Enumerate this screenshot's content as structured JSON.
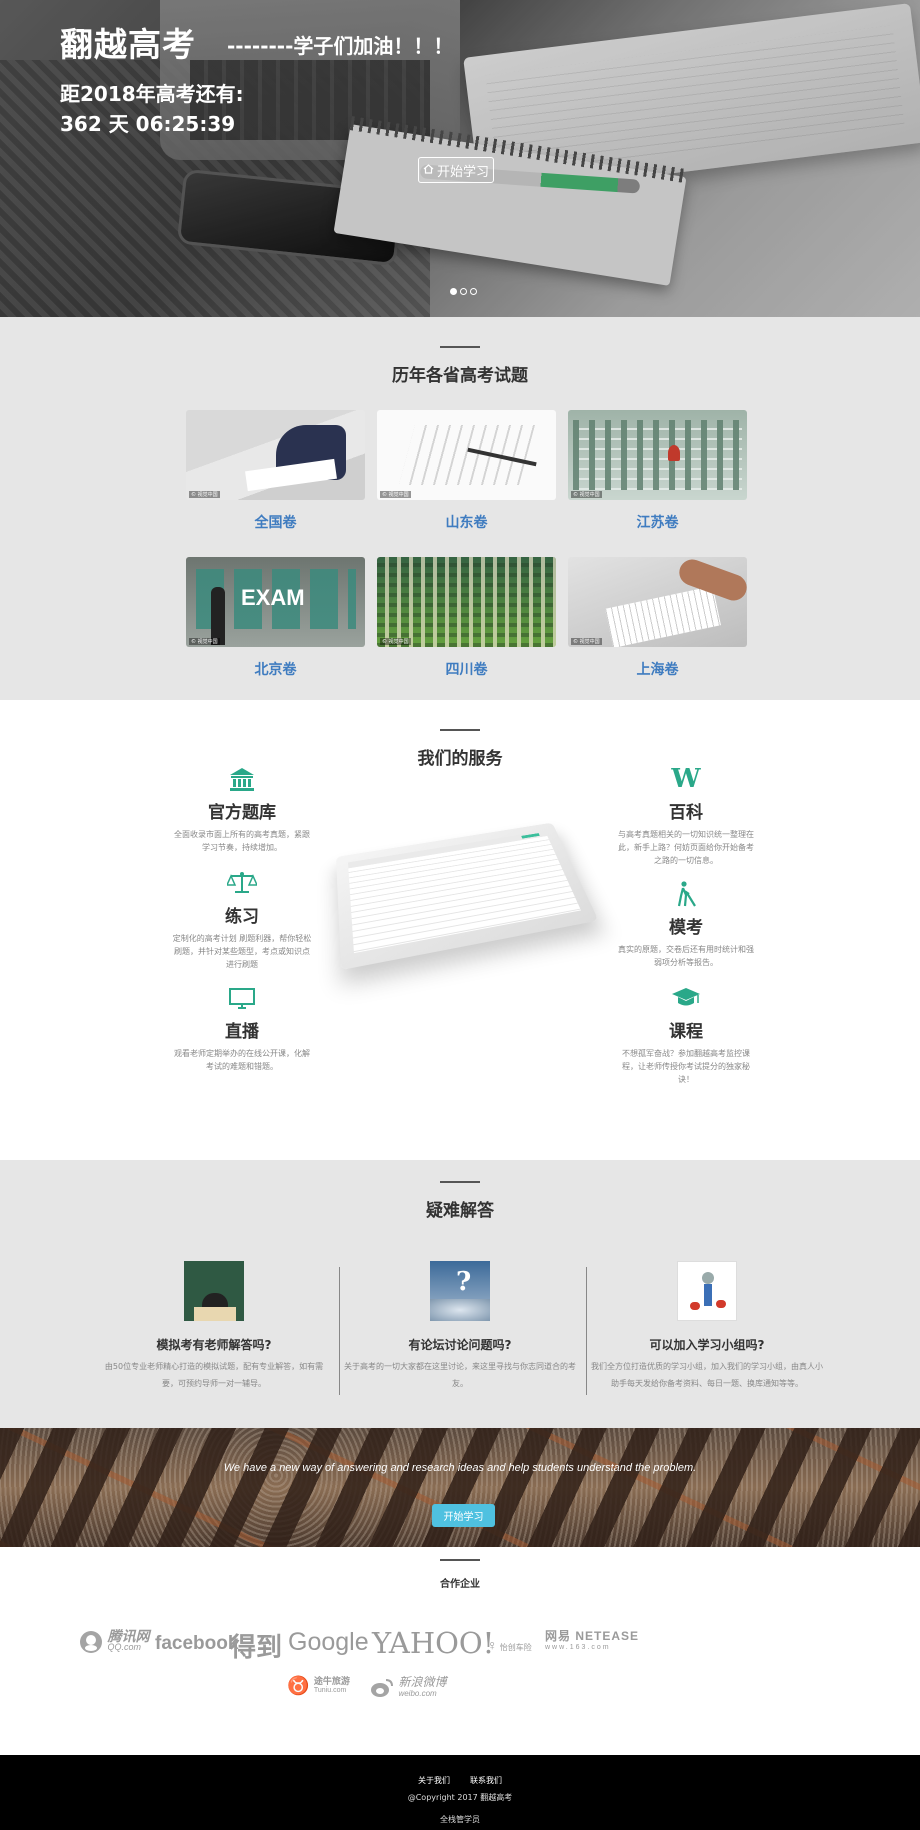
{
  "hero": {
    "brand": "翻越高考",
    "slogan": "--------学子们加油！！！",
    "countdown_label": "距2018年高考还有:",
    "countdown_value": "362 天 06:25:39",
    "start_button": "开始学习",
    "carousel_dots": 3,
    "active_dot": 1
  },
  "exams": {
    "title": "历年各省高考试题",
    "items": [
      {
        "label": "全国卷"
      },
      {
        "label": "山东卷"
      },
      {
        "label": "江苏卷"
      },
      {
        "label": "北京卷"
      },
      {
        "label": "四川卷"
      },
      {
        "label": "上海卷"
      }
    ],
    "image_tag": "© 视觉中国",
    "exam_board_text": "EXAM",
    "link_color": "#3f7cc0"
  },
  "services": {
    "title": "我们的服务",
    "accent_color": "#2aa889",
    "items": [
      {
        "icon": "bank-icon",
        "title": "官方题库",
        "desc": "全面收录市面上所有的高考真题，紧跟学习节奏，持续增加。"
      },
      {
        "icon": "wikipedia-icon",
        "title": "百科",
        "desc": "与高考真题相关的一切知识统一整理在此，新手上路？何妨页面给你开始备考之路的一切信息。"
      },
      {
        "icon": "balance-scale-icon",
        "title": "练习",
        "desc": "定制化的高考计划 刷题利器，帮你轻松刷题，并针对某些题型，考点或知识点进行刷题"
      },
      {
        "icon": "blind-walker-icon",
        "title": "模考",
        "desc": "真实的原题，交卷后还有用时统计和强弱项分析等报告。"
      },
      {
        "icon": "desktop-icon",
        "title": "直播",
        "desc": "观看老师定期举办的在线公开课，化解考试的难题和错题。"
      },
      {
        "icon": "graduation-cap-icon",
        "title": "课程",
        "desc": "不想孤军奋战？参加翻越高考监控课程，让老师传授你考试提分的独家秘诀！"
      }
    ]
  },
  "qa": {
    "title": "疑难解答",
    "items": [
      {
        "title": "模拟考有老师解答吗?",
        "desc": "由50位专业老师精心打造的模拟试题，配有专业解答，如有需要，可预约导师一对一辅导。"
      },
      {
        "title": "有论坛讨论问题吗?",
        "desc": "关于高考的一切大家都在这里讨论，来这里寻找与你志同道合的考友。"
      },
      {
        "title": "可以加入学习小组吗?",
        "desc": "我们全方位打造优质的学习小组，加入我们的学习小组，由真人小助手每天发给你备考资料、每日一题、换库通知等等。"
      }
    ]
  },
  "cta": {
    "text": "We have a new way of answering and research ideas and help students understand the problem.",
    "button": "开始学习",
    "button_color": "#4fc1e0"
  },
  "partners": {
    "title": "合作企业",
    "logos": {
      "qq": "腾讯网",
      "qq_sub": "QQ.com",
      "facebook": "facebook",
      "dedao": "得到",
      "google": "Google",
      "yahoo": "YAHOO!",
      "huiyi": "怡创车险",
      "netease": "网易 NETEASE",
      "netease_sub": "www.163.com",
      "tuniu": "途牛旅游",
      "tuniu_sub": "Tuniu.com",
      "weibo": "新浪微博",
      "weibo_sub": "weibo.com"
    }
  },
  "footer": {
    "about": "关于我们",
    "contact": "联系我们",
    "copyright": "@Copyright 2017 翻越高考",
    "admin": "全栈管学员"
  }
}
